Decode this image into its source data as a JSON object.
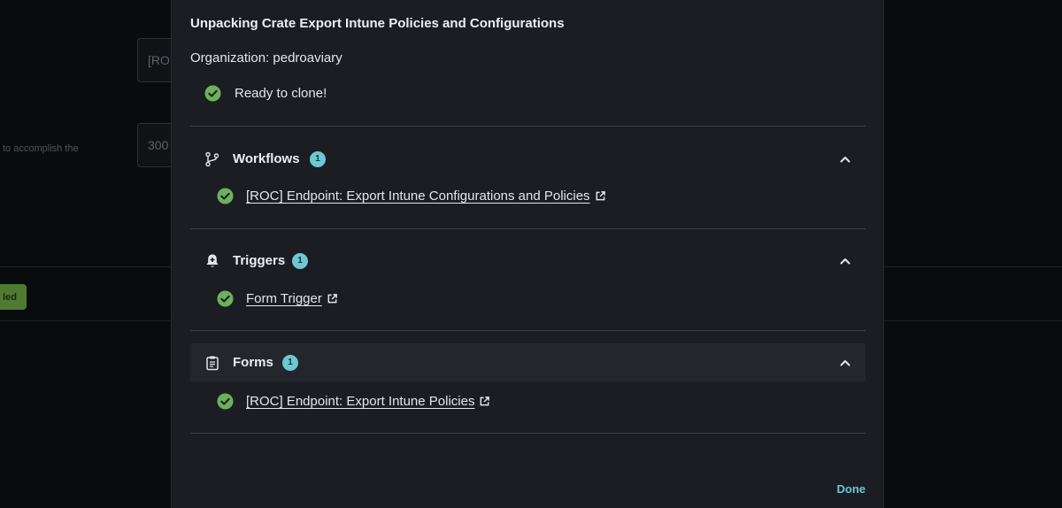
{
  "background": {
    "input_1_value": "[RO",
    "input_2_value": "300",
    "side_text": "to accomplish the",
    "badge_text": "led"
  },
  "modal": {
    "title": "Unpacking Crate Export Intune Policies and Configurations",
    "organization": "Organization: pedroaviary",
    "ready_text": "Ready to clone!",
    "done_label": "Done"
  },
  "sections": [
    {
      "label": "Workflows",
      "count": "1",
      "icon": "git-branch-icon",
      "items": [
        {
          "label": "[ROC] Endpoint: Export Intune Configurations and Policies",
          "status": "success"
        }
      ]
    },
    {
      "label": "Triggers",
      "count": "1",
      "icon": "bell-plus-icon",
      "items": [
        {
          "label": "Form Trigger",
          "status": "success"
        }
      ]
    },
    {
      "label": "Forms",
      "count": "1",
      "icon": "clipboard-icon",
      "items": [
        {
          "label": "[ROC] Endpoint: Export Intune Policies",
          "status": "success"
        }
      ]
    }
  ],
  "colors": {
    "accent": "#6cc8d4",
    "success": "#6fb05c",
    "modal_bg": "#1b1d23",
    "page_bg": "#0a0b0e"
  }
}
